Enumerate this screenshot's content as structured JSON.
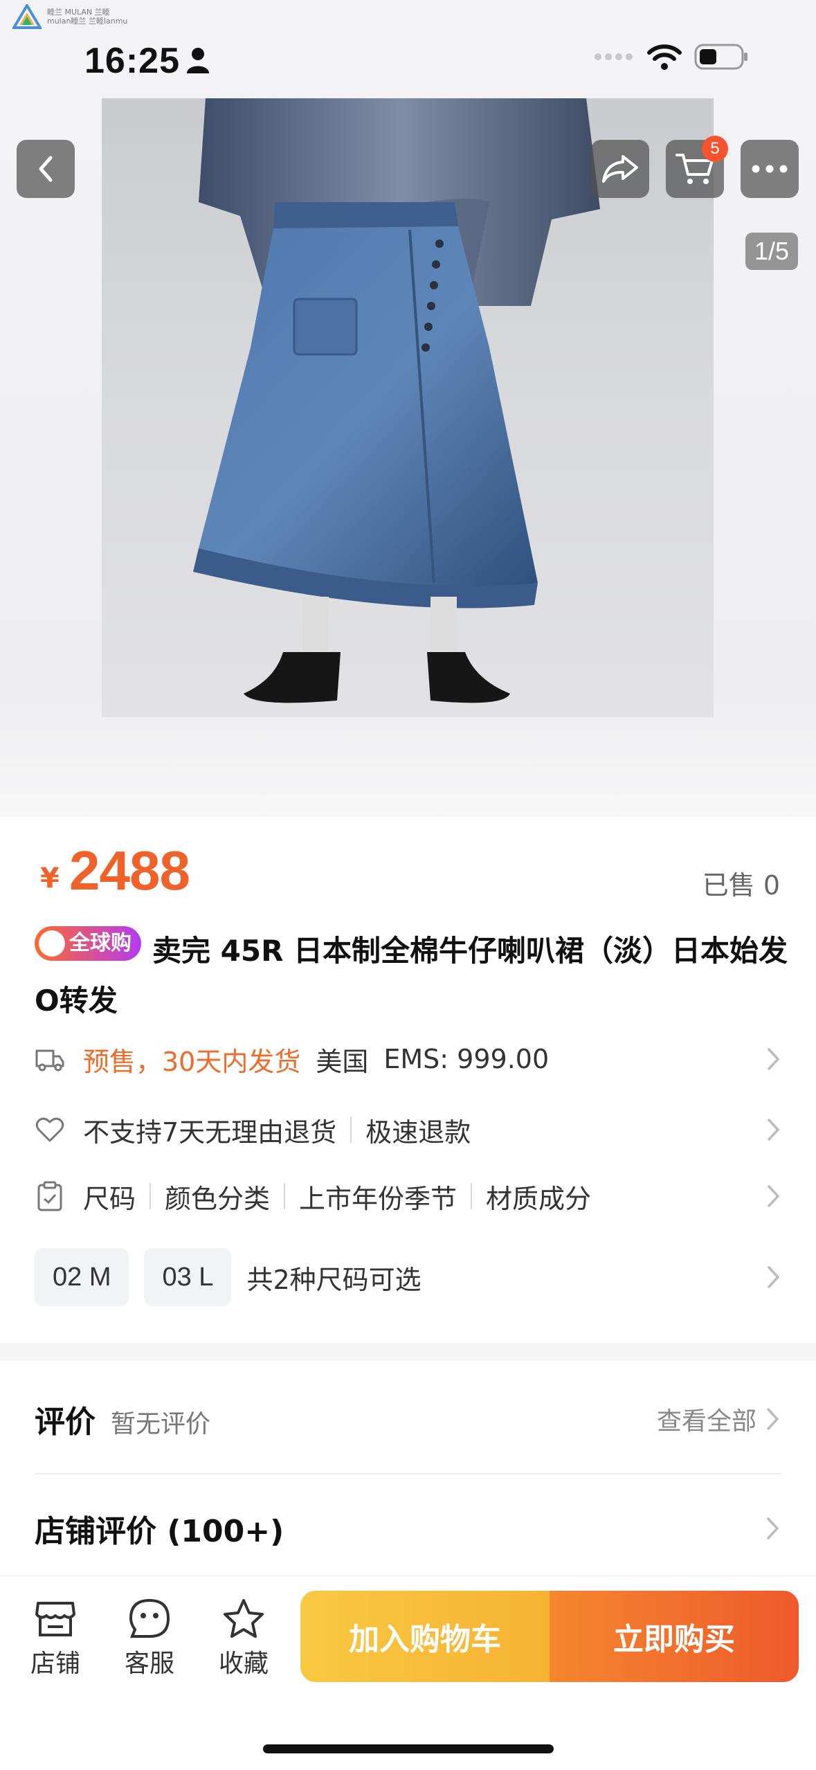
{
  "watermark": {
    "line1": "睦兰 MULAN 兰睦",
    "line2": "mulan睦兰 兰睦lanmu"
  },
  "status_bar": {
    "time": "16:25"
  },
  "nav": {
    "cart_count": "5",
    "image_counter": "1/5"
  },
  "product": {
    "price_symbol": "¥",
    "price": "2488",
    "sold": "已售 0",
    "tag": "全球购",
    "title": "卖完 45R 日本制全棉牛仔喇叭裙（淡）日本始发O转发"
  },
  "shipping": {
    "presale": "预售，30天内发货",
    "origin": "美国",
    "ems": "EMS: 999.00"
  },
  "returns": {
    "policy": "不支持7天无理由退货",
    "refund": "极速退款"
  },
  "params": {
    "items": [
      "尺码",
      "颜色分类",
      "上市年份季节",
      "材质成分"
    ]
  },
  "sizes": {
    "options": [
      "02 M",
      "03 L"
    ],
    "summary": "共2种尺码可选"
  },
  "reviews": {
    "label": "评价",
    "empty": "暂无评价",
    "view_all": "查看全部",
    "shop_reviews": "店铺评价 (100+)"
  },
  "bottom_bar": {
    "shop": "店铺",
    "service": "客服",
    "favorite": "收藏",
    "add_to_cart": "加入购物车",
    "buy_now": "立即购买"
  },
  "colors": {
    "accent": "#f0622a",
    "cart_btn": "#f7b733",
    "buy_btn": "#ef5a2d",
    "badge": "#f5542d"
  }
}
